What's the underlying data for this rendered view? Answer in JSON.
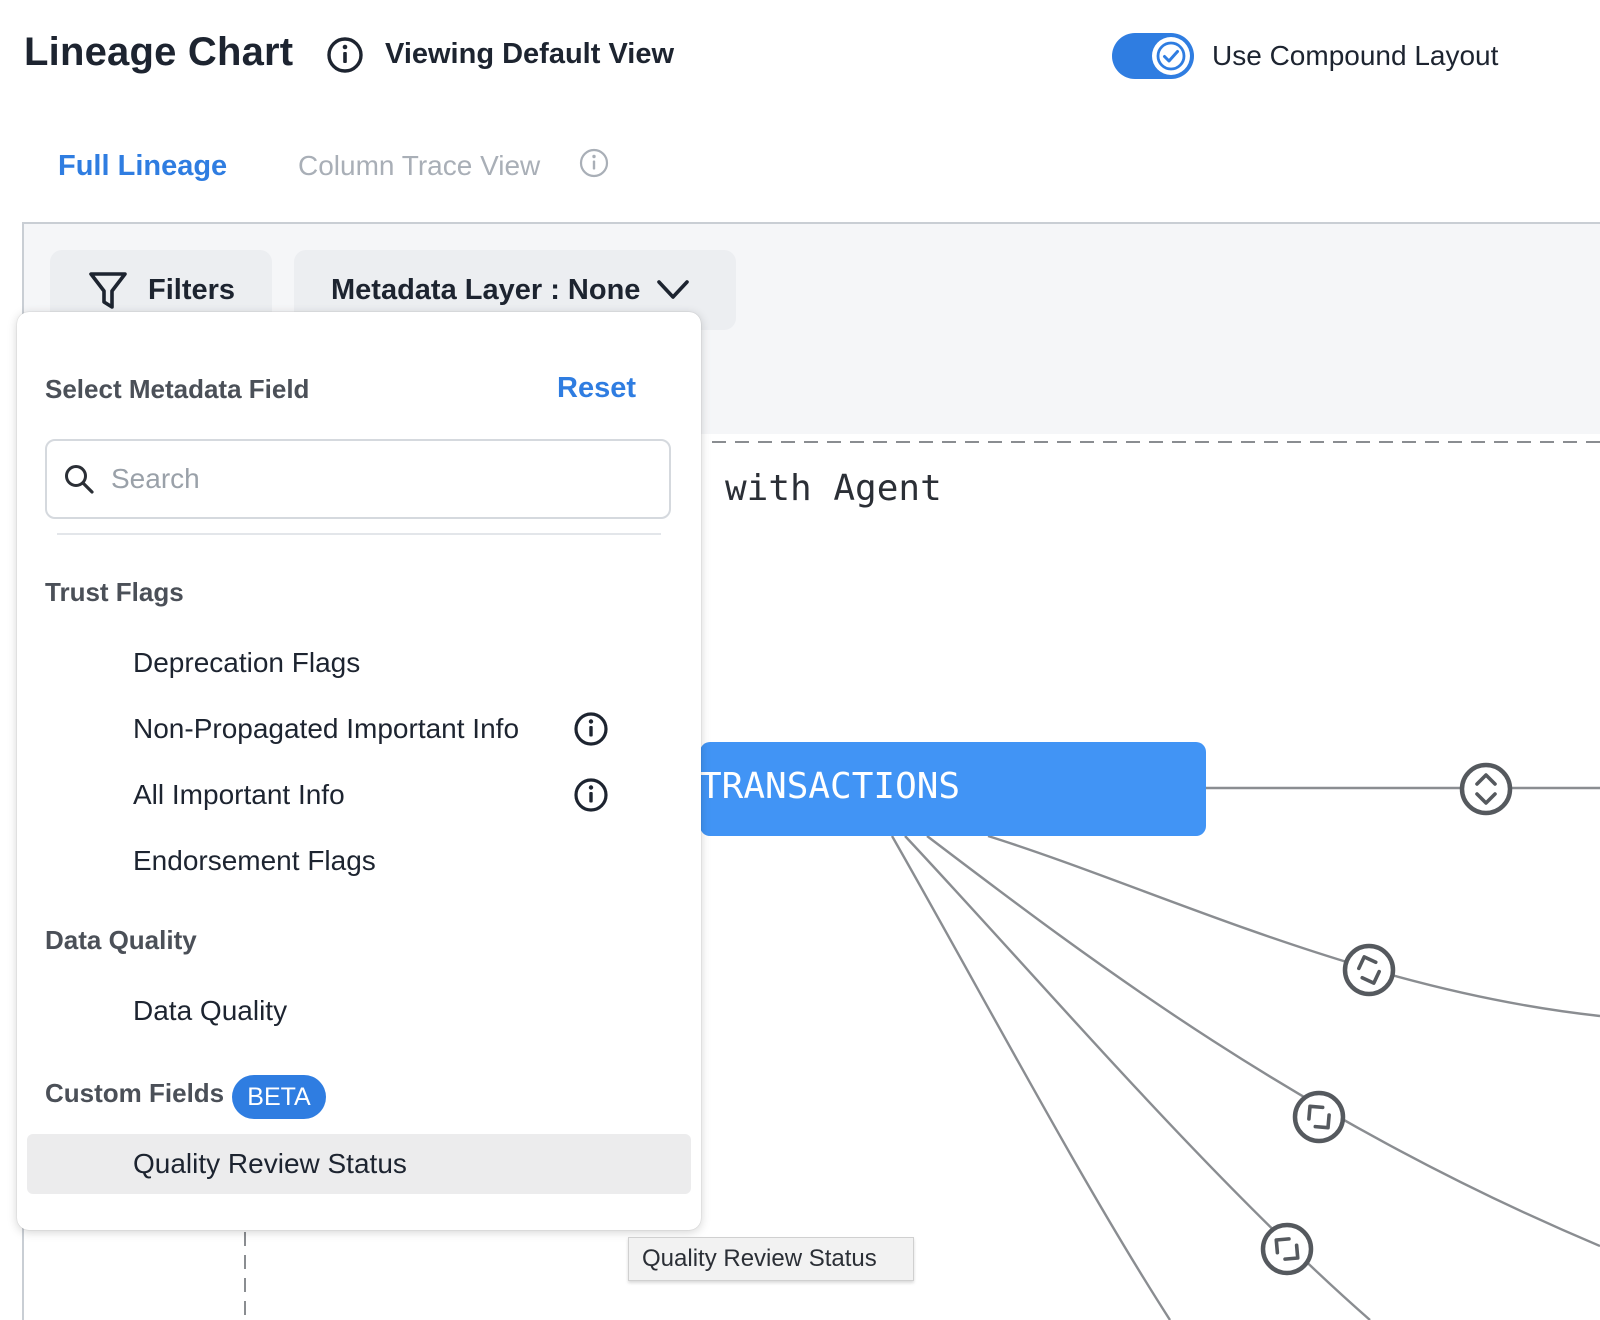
{
  "header": {
    "title": "Lineage Chart",
    "view_label": "Viewing Default View",
    "compound_toggle": {
      "label": "Use Compound Layout",
      "checked": true
    }
  },
  "tabs": [
    {
      "label": "Full Lineage",
      "active": true
    },
    {
      "label": "Column Trace View",
      "active": false
    }
  ],
  "toolbar": {
    "filters_label": "Filters",
    "metadata_layer_label": "Metadata Layer : None"
  },
  "graph": {
    "swimlane_title": "with Agent",
    "node_label": "TRANSACTIONS"
  },
  "dropdown": {
    "title": "Select Metadata Field",
    "reset_label": "Reset",
    "search": {
      "placeholder": "Search",
      "value": ""
    },
    "groups": [
      {
        "label": "Trust Flags",
        "items": [
          {
            "label": "Deprecation Flags",
            "info": false
          },
          {
            "label": "Non-Propagated Important Info",
            "info": true
          },
          {
            "label": "All Important Info",
            "info": true
          },
          {
            "label": "Endorsement Flags",
            "info": false
          }
        ]
      },
      {
        "label": "Data Quality",
        "items": [
          {
            "label": "Data Quality",
            "info": false
          }
        ]
      },
      {
        "label": "Custom Fields",
        "badge": "BETA",
        "items": [
          {
            "label": "Quality Review Status",
            "info": false,
            "hovered": true
          }
        ]
      }
    ]
  },
  "tooltip": {
    "text": "Quality Review Status"
  },
  "colors": {
    "accent": "#2f7de1",
    "node": "#4194f5",
    "edge": "#8a8d91",
    "hover_bg": "#ececed"
  }
}
